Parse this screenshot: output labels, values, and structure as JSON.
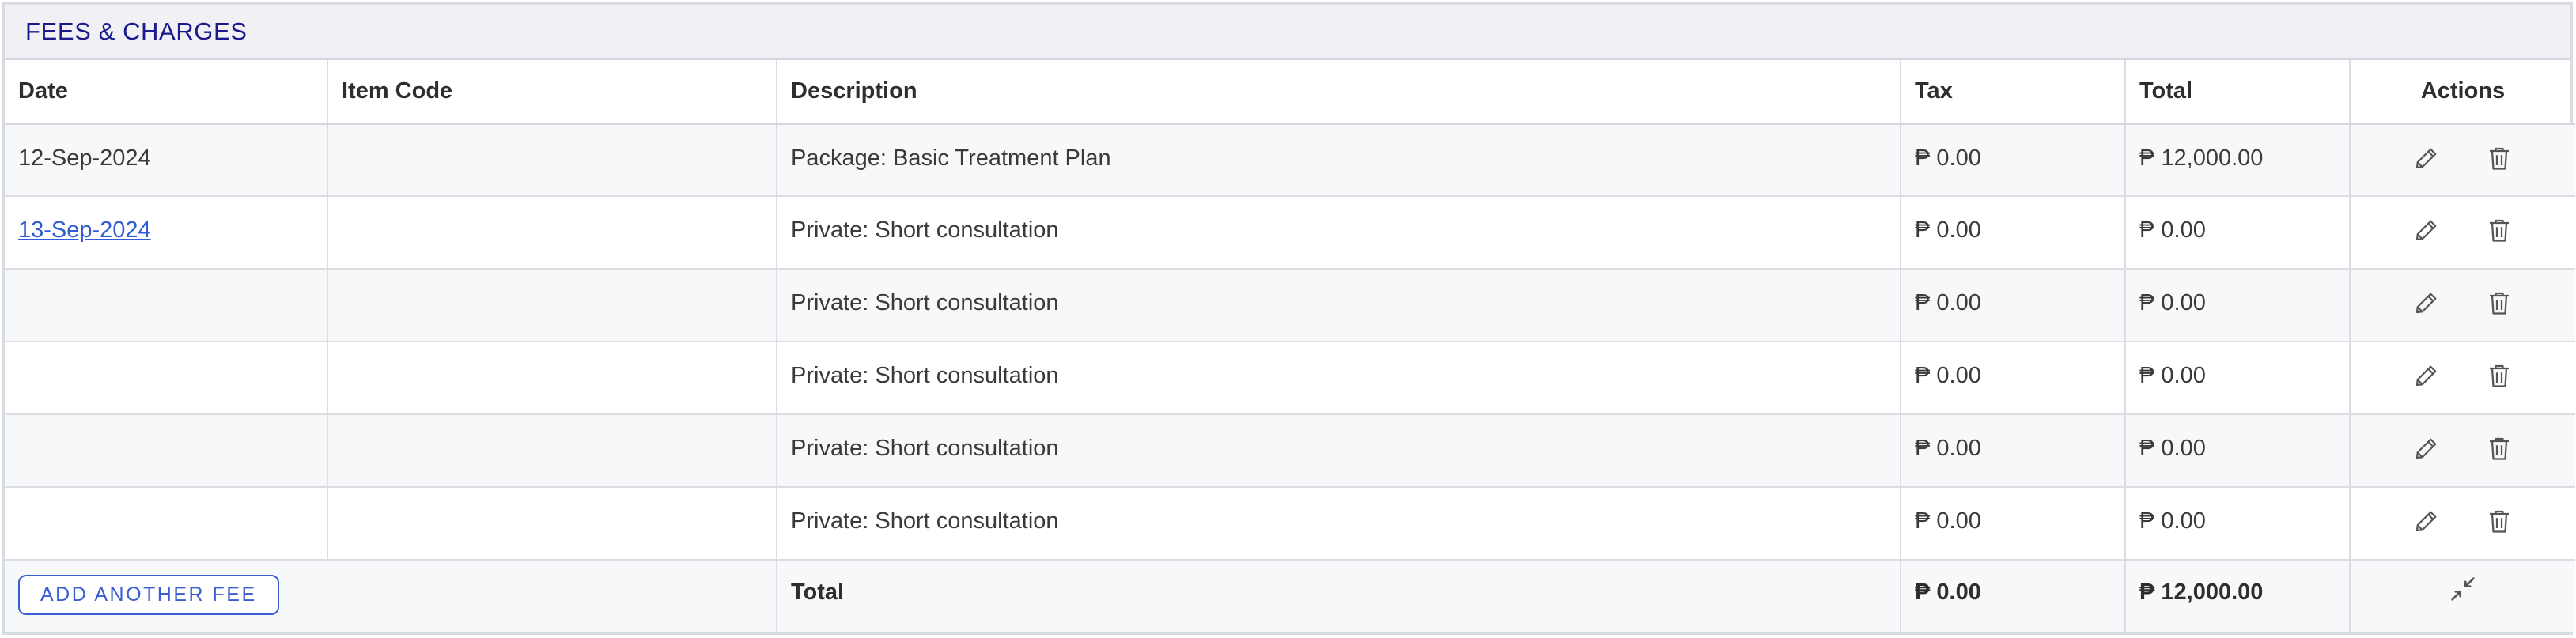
{
  "panel": {
    "title": "FEES & CHARGES"
  },
  "columns": {
    "date": "Date",
    "item_code": "Item Code",
    "description": "Description",
    "tax": "Tax",
    "total": "Total",
    "actions": "Actions"
  },
  "rows": [
    {
      "date": "12-Sep-2024",
      "date_is_link": false,
      "item_code": "",
      "description": "Package: Basic Treatment Plan",
      "tax": "₱ 0.00",
      "total": "₱ 12,000.00"
    },
    {
      "date": "13-Sep-2024",
      "date_is_link": true,
      "item_code": "",
      "description": "Private: Short consultation",
      "tax": "₱ 0.00",
      "total": "₱ 0.00"
    },
    {
      "date": "",
      "date_is_link": false,
      "item_code": "",
      "description": "Private: Short consultation",
      "tax": "₱ 0.00",
      "total": "₱ 0.00"
    },
    {
      "date": "",
      "date_is_link": false,
      "item_code": "",
      "description": "Private: Short consultation",
      "tax": "₱ 0.00",
      "total": "₱ 0.00"
    },
    {
      "date": "",
      "date_is_link": false,
      "item_code": "",
      "description": "Private: Short consultation",
      "tax": "₱ 0.00",
      "total": "₱ 0.00"
    },
    {
      "date": "",
      "date_is_link": false,
      "item_code": "",
      "description": "Private: Short consultation",
      "tax": "₱ 0.00",
      "total": "₱ 0.00"
    }
  ],
  "footer": {
    "add_button_label": "ADD ANOTHER FEE",
    "total_label": "Total",
    "total_tax": "₱ 0.00",
    "grand_total": "₱ 12,000.00"
  },
  "icons": {
    "edit": "pencil-icon",
    "delete": "trash-icon",
    "collapse": "collapse-arrows-icon"
  },
  "colors": {
    "title": "#1a1a8c",
    "link": "#2f5bd8",
    "button_accent": "#3a5ed0"
  }
}
